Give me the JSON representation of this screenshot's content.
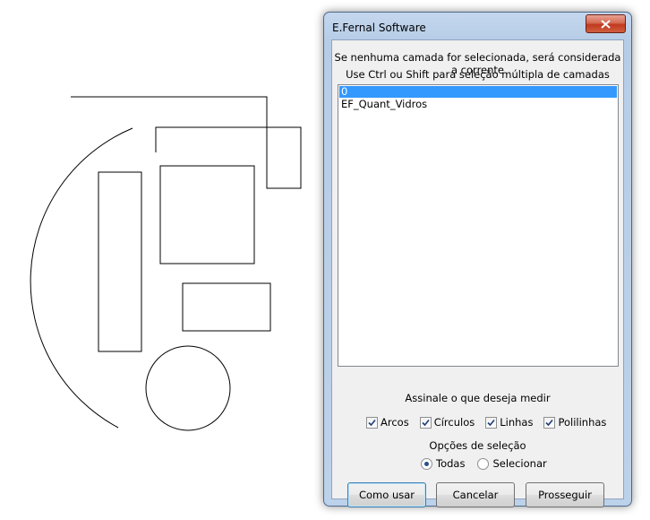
{
  "window": {
    "title": "E.Fernal Software"
  },
  "info": {
    "line1": "Se nenhuma camada for selecionada, será considerada a corrente",
    "line2": "Use Ctrl ou Shift para seleção múltipla de camadas"
  },
  "layers": [
    {
      "label": "0",
      "selected": true
    },
    {
      "label": "EF_Quant_Vidros",
      "selected": false
    }
  ],
  "measure": {
    "label": "Assinale o que deseja medir",
    "options": [
      {
        "label": "Arcos",
        "checked": true
      },
      {
        "label": "Círculos",
        "checked": true
      },
      {
        "label": "Linhas",
        "checked": true
      },
      {
        "label": "Polilinhas",
        "checked": true
      }
    ]
  },
  "selection": {
    "label": "Opções de seleção",
    "options": [
      {
        "label": "Todas",
        "selected": true
      },
      {
        "label": "Selecionar",
        "selected": false
      }
    ]
  },
  "buttons": {
    "help": "Como usar",
    "cancel": "Cancelar",
    "proceed": "Prosseguir"
  }
}
